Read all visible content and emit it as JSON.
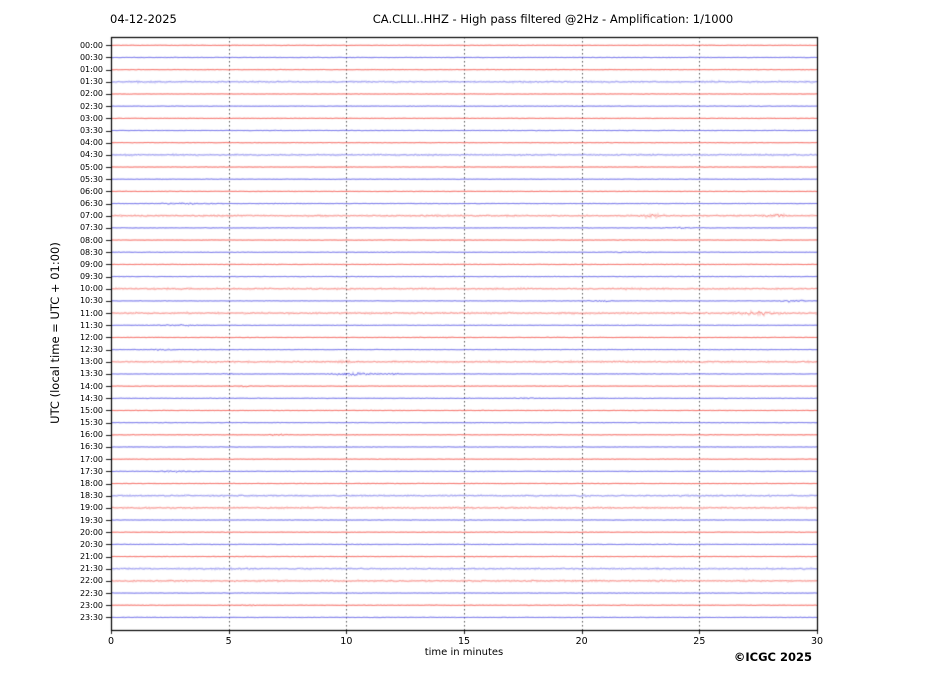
{
  "header": {
    "date": "04-12-2025",
    "title": "CA.CLLI..HHZ - High pass filtered @2Hz - Amplification: 1/1000"
  },
  "axes": {
    "ylabel": "UTC (local time = UTC + 01:00)",
    "xlabel": "time in minutes"
  },
  "footer": {
    "copyright": "©ICGC 2025"
  },
  "chart_data": {
    "type": "line",
    "subtype": "helicorder-drum-record",
    "station": "CA.CLLI..HHZ",
    "processing": "High pass filtered @2Hz",
    "amplification": "1/1000",
    "record_date": "04-12-2025",
    "title": "CA.CLLI..HHZ - High pass filtered @2Hz - Amplification: 1/1000",
    "xlabel": "time in minutes",
    "ylabel": "UTC (local time = UTC + 01:00)",
    "x_range": [
      0,
      30
    ],
    "x_ticks": [
      0,
      5,
      10,
      15,
      20,
      25,
      30
    ],
    "gridlines_x": [
      5,
      10,
      15,
      20,
      25
    ],
    "grid_style": "vertical dotted gray",
    "row_interval_minutes": 30,
    "trace_colors": {
      "red": "#f23a30",
      "blue": "#4343e2"
    },
    "grid_color": "#555555",
    "rows": [
      {
        "label": "00:00",
        "color": "red",
        "soft": false,
        "events": []
      },
      {
        "label": "00:30",
        "color": "blue",
        "soft": false,
        "events": []
      },
      {
        "label": "01:00",
        "color": "red",
        "soft": false,
        "events": []
      },
      {
        "label": "01:30",
        "color": "blue",
        "soft": true,
        "events": []
      },
      {
        "label": "02:00",
        "color": "red",
        "soft": false,
        "events": []
      },
      {
        "label": "02:30",
        "color": "blue",
        "soft": false,
        "events": []
      },
      {
        "label": "03:00",
        "color": "red",
        "soft": false,
        "events": []
      },
      {
        "label": "03:30",
        "color": "blue",
        "soft": false,
        "events": []
      },
      {
        "label": "04:00",
        "color": "red",
        "soft": false,
        "events": []
      },
      {
        "label": "04:30",
        "color": "blue",
        "soft": true,
        "events": []
      },
      {
        "label": "05:00",
        "color": "red",
        "soft": false,
        "events": []
      },
      {
        "label": "05:30",
        "color": "blue",
        "soft": false,
        "events": []
      },
      {
        "label": "06:00",
        "color": "red",
        "soft": false,
        "events": []
      },
      {
        "label": "06:30",
        "color": "blue",
        "soft": false,
        "events": [
          [
            3.3,
            2.6,
            1.0
          ]
        ]
      },
      {
        "label": "07:00",
        "color": "red",
        "soft": true,
        "events": [
          [
            23.0,
            0.9,
            2.0
          ],
          [
            28.3,
            0.9,
            2.0
          ]
        ]
      },
      {
        "label": "07:30",
        "color": "blue",
        "soft": false,
        "events": [
          [
            24.3,
            1.3,
            0.9
          ]
        ]
      },
      {
        "label": "08:00",
        "color": "red",
        "soft": false,
        "events": []
      },
      {
        "label": "08:30",
        "color": "blue",
        "soft": false,
        "events": [
          [
            22.2,
            1.5,
            0.7
          ]
        ]
      },
      {
        "label": "09:00",
        "color": "red",
        "soft": false,
        "events": []
      },
      {
        "label": "09:30",
        "color": "blue",
        "soft": false,
        "events": []
      },
      {
        "label": "10:00",
        "color": "red",
        "soft": true,
        "events": []
      },
      {
        "label": "10:30",
        "color": "blue",
        "soft": false,
        "events": [
          [
            20.9,
            0.7,
            1.0
          ],
          [
            29.0,
            1.1,
            1.5
          ]
        ]
      },
      {
        "label": "11:00",
        "color": "red",
        "soft": true,
        "events": [
          [
            27.5,
            1.7,
            2.0
          ]
        ]
      },
      {
        "label": "11:30",
        "color": "blue",
        "soft": false,
        "events": [
          [
            2.9,
            1.7,
            0.9
          ]
        ]
      },
      {
        "label": "12:00",
        "color": "red",
        "soft": false,
        "events": []
      },
      {
        "label": "12:30",
        "color": "blue",
        "soft": false,
        "events": [
          [
            2.2,
            1.1,
            1.1
          ]
        ]
      },
      {
        "label": "13:00",
        "color": "red",
        "soft": true,
        "events": [
          [
            10.0,
            0.6,
            0.9
          ]
        ]
      },
      {
        "label": "13:30",
        "color": "blue",
        "soft": false,
        "events": [
          [
            5.0,
            0.7,
            0.9
          ],
          [
            10.3,
            1.7,
            2.2
          ],
          [
            11.9,
            0.9,
            1.0
          ]
        ]
      },
      {
        "label": "14:00",
        "color": "red",
        "soft": false,
        "events": [
          [
            5.6,
            0.6,
            0.9
          ]
        ]
      },
      {
        "label": "14:30",
        "color": "blue",
        "soft": false,
        "events": [
          [
            17.8,
            0.9,
            0.7
          ]
        ]
      },
      {
        "label": "15:00",
        "color": "red",
        "soft": false,
        "events": []
      },
      {
        "label": "15:30",
        "color": "blue",
        "soft": false,
        "events": []
      },
      {
        "label": "16:00",
        "color": "red",
        "soft": false,
        "events": [
          [
            7.1,
            0.8,
            1.1
          ]
        ]
      },
      {
        "label": "16:30",
        "color": "blue",
        "soft": false,
        "events": []
      },
      {
        "label": "17:00",
        "color": "red",
        "soft": false,
        "events": []
      },
      {
        "label": "17:30",
        "color": "blue",
        "soft": false,
        "events": [
          [
            2.6,
            1.3,
            0.9
          ]
        ]
      },
      {
        "label": "18:00",
        "color": "red",
        "soft": false,
        "events": []
      },
      {
        "label": "18:30",
        "color": "blue",
        "soft": true,
        "events": []
      },
      {
        "label": "19:00",
        "color": "red",
        "soft": true,
        "events": []
      },
      {
        "label": "19:30",
        "color": "blue",
        "soft": false,
        "events": []
      },
      {
        "label": "20:00",
        "color": "red",
        "soft": false,
        "events": []
      },
      {
        "label": "20:30",
        "color": "blue",
        "soft": false,
        "events": []
      },
      {
        "label": "21:00",
        "color": "red",
        "soft": false,
        "events": []
      },
      {
        "label": "21:30",
        "color": "blue",
        "soft": true,
        "events": []
      },
      {
        "label": "22:00",
        "color": "red",
        "soft": true,
        "events": []
      },
      {
        "label": "22:30",
        "color": "blue",
        "soft": false,
        "events": []
      },
      {
        "label": "23:00",
        "color": "red",
        "soft": false,
        "events": [
          [
            5.9,
            0.6,
            0.8
          ]
        ]
      },
      {
        "label": "23:30",
        "color": "blue",
        "soft": false,
        "events": []
      }
    ]
  }
}
